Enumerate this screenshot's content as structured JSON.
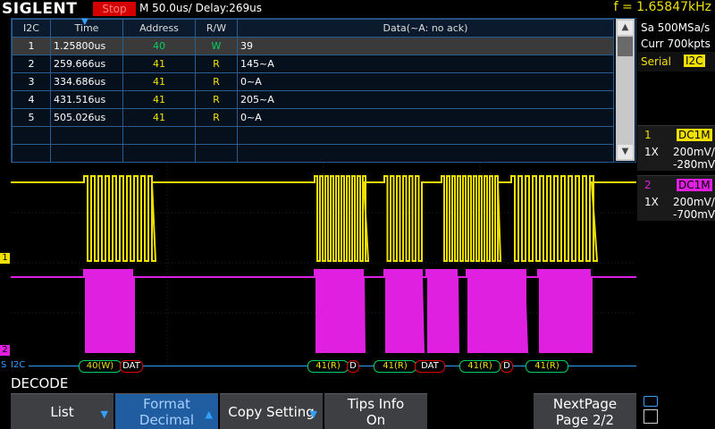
{
  "header": {
    "brand": "SIGLENT",
    "state": "Stop",
    "timebase": "M 50.0us/  Delay:269us",
    "frequency": "f = 1.65847kHz"
  },
  "acquisition": {
    "sample_rate": "Sa 500MSa/s",
    "memory": "Curr 700kpts",
    "trigger_label": "Serial",
    "trigger_source": "I2C"
  },
  "channels": [
    {
      "num": "1",
      "coupling": "DC1M",
      "probe": "1X",
      "scale": "200mV/",
      "offset": "-280mV",
      "color": "#f0e000"
    },
    {
      "num": "2",
      "coupling": "DC1M",
      "probe": "1X",
      "scale": "200mV/",
      "offset": "-700mV",
      "color": "#e020e0"
    }
  ],
  "decode_table": {
    "columns": [
      "I2C",
      "Time",
      "Address",
      "R/W",
      "Data(~A: no ack)"
    ],
    "rows": [
      {
        "idx": "1",
        "time": "1.25800us",
        "address": "40",
        "rw": "W",
        "data": "39"
      },
      {
        "idx": "2",
        "time": "259.666us",
        "address": "41",
        "rw": "R",
        "data": "145~A"
      },
      {
        "idx": "3",
        "time": "334.686us",
        "address": "41",
        "rw": "R",
        "data": "0~A"
      },
      {
        "idx": "4",
        "time": "431.516us",
        "address": "41",
        "rw": "R",
        "data": "205~A"
      },
      {
        "idx": "5",
        "time": "505.026us",
        "address": "41",
        "rw": "R",
        "data": "0~A"
      }
    ]
  },
  "decode_bar": {
    "label": "I2C",
    "marker": "S",
    "segments": [
      "40(W)",
      "DAT",
      "41(R)",
      "D",
      "41(R)",
      "DAT",
      "41(R)",
      "D",
      "41(R)"
    ]
  },
  "markers": {
    "ch1": "1",
    "ch2": "2"
  },
  "bottom": {
    "title": "DECODE",
    "softkeys": [
      {
        "line1": "List",
        "line2": ""
      },
      {
        "line1": "Format",
        "line2": "Decimal"
      },
      {
        "line1": "Copy Setting",
        "line2": ""
      },
      {
        "line1": "Tips Info",
        "line2": "On"
      },
      {
        "line1": "NextPage",
        "line2": "Page 2/2"
      }
    ]
  },
  "colors": {
    "ch1": "#f0e000",
    "ch2": "#e020e0",
    "accent": "#33a0ff",
    "decode": "#00d060"
  }
}
